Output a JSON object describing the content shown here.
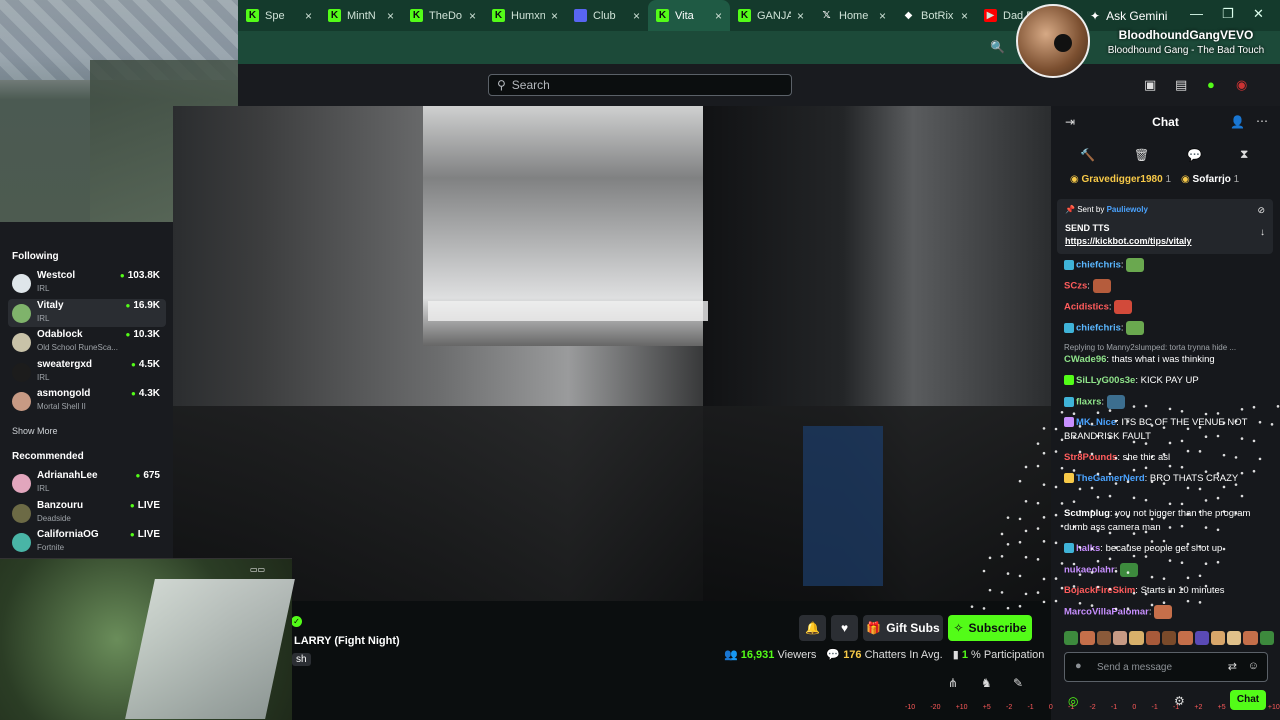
{
  "browser": {
    "tabs": [
      {
        "label": "Spe",
        "fav": "kick",
        "active": false
      },
      {
        "label": "MintN",
        "fav": "kick",
        "active": false
      },
      {
        "label": "TheDo",
        "fav": "kick",
        "active": false
      },
      {
        "label": "Humxn",
        "fav": "kick",
        "active": false
      },
      {
        "label": "Club",
        "fav": "discord",
        "active": false
      },
      {
        "label": "Vita",
        "fav": "kick",
        "active": true
      },
      {
        "label": "GANJA",
        "fav": "kick",
        "active": false
      },
      {
        "label": "Home",
        "fav": "x",
        "active": false
      },
      {
        "label": "BotRix",
        "fav": "botrix",
        "active": false
      },
      {
        "label": "Dad D",
        "fav": "yt",
        "active": false
      }
    ],
    "ask_gemini": "Ask Gemini",
    "zoom_icon": "search-icon"
  },
  "header": {
    "search_placeholder": "Search"
  },
  "now_playing": {
    "artist": "BloodhoundGangVEVO",
    "track": "Bloodhound Gang - The Bad Touch"
  },
  "sidebar": {
    "following_heading": "Following",
    "following": [
      {
        "name": "Westcol",
        "category": "IRL",
        "viewers": "103.8K",
        "color": "#dfe6ea",
        "selected": false
      },
      {
        "name": "Vitaly",
        "category": "IRL",
        "viewers": "16.9K",
        "color": "#7fb36b",
        "selected": true
      },
      {
        "name": "Odablock",
        "category": "Old School RuneSca...",
        "viewers": "10.3K",
        "color": "#c8c2a8",
        "selected": false
      },
      {
        "name": "sweatergxd",
        "category": "IRL",
        "viewers": "4.5K",
        "color": "#1c1c1c",
        "selected": false
      },
      {
        "name": "asmongold",
        "category": "Mortal Shell II",
        "viewers": "4.3K",
        "color": "#c79a84",
        "selected": false
      }
    ],
    "show_more": "Show More",
    "recommended_heading": "Recommended",
    "recommended": [
      {
        "name": "AdrianahLee",
        "category": "IRL",
        "viewers": "675",
        "color": "#e2a6bd"
      },
      {
        "name": "Banzouru",
        "category": "Deadside",
        "viewers": "LIVE",
        "color": "#6c6a45"
      },
      {
        "name": "CaliforniaOG",
        "category": "Fortnite",
        "viewers": "LIVE",
        "color": "#49b5a6"
      }
    ]
  },
  "stream": {
    "title": "LARRY (Fight Night)",
    "category": "sh",
    "gift_subs": "Gift Subs",
    "subscribe": "Subscribe",
    "viewers_count": "16,931",
    "viewers_label": "Viewers",
    "chatters_count": "176",
    "chatters_label": "Chatters In Avg.",
    "participation_value": "1",
    "participation_label": "% Participation"
  },
  "chat": {
    "title": "Chat",
    "leaderboard": [
      {
        "name": "Gravedigger1980",
        "count": "1",
        "color": "#f7c948"
      },
      {
        "name": "Sofarrjo",
        "count": "1",
        "color": "#fff"
      }
    ],
    "pinned": {
      "sent_by": "Sent by",
      "user": "Pauliewoly",
      "message": "SEND TTS",
      "link": "https://kickbot.com/tips/vitaly"
    },
    "reply_hint": "Replying to Manny2slumped: torta trynna hide ...",
    "messages": [
      {
        "user": "chiefchris",
        "color": "#5ab7ff",
        "text": "",
        "emote": "#6aa84f",
        "badge": "#3fb3d8"
      },
      {
        "user": "SCzs",
        "color": "#ff5c5c",
        "text": "",
        "emote": "#b55c3c",
        "badge": ""
      },
      {
        "user": "Acidistics",
        "color": "#ff5c5c",
        "text": "",
        "emote": "#d24a3a",
        "badge": ""
      },
      {
        "user": "chiefchris",
        "color": "#5ab7ff",
        "text": "",
        "emote": "#6aa84f",
        "badge": "#3fb3d8"
      },
      {
        "user": "CWade96",
        "color": "#8fe38a",
        "text": "thats what i was thinking",
        "emote": "",
        "badge": ""
      },
      {
        "user": "SiLLyG00s3e",
        "color": "#8fe38a",
        "text": "KICK PAY UP",
        "emote": "",
        "badge": "#53fc18"
      },
      {
        "user": "flaxrs",
        "color": "#8fe38a",
        "text": "",
        "emote": "#3c6e8f",
        "badge": "#3fb3d8"
      },
      {
        "user": "MK_Nice",
        "color": "#4aa3ff",
        "text": "ITS BC OF THE VENUE NOT BRANDRISK FAULT",
        "emote": "",
        "badge": "#c78fff"
      },
      {
        "user": "Str8Pounds",
        "color": "#ff5c5c",
        "text": "she thic asl",
        "emote": "",
        "badge": ""
      },
      {
        "user": "TheGamerNerd",
        "color": "#4aa3ff",
        "text": "BRO THATS CRAZY",
        "emote": "",
        "badge": "#f7c948"
      },
      {
        "user": "Scumplug",
        "color": "#fff",
        "text": "you not bigger than the program dumb ass camera man",
        "emote": "",
        "badge": ""
      },
      {
        "user": "halks",
        "color": "#c78fff",
        "text": "because people get shot up",
        "emote": "",
        "badge": "#3fb3d8"
      },
      {
        "user": "nukaeolahr",
        "color": "#c78fff",
        "text": "",
        "emote": "#3d8a3d",
        "badge": ""
      },
      {
        "user": "BojackFireSkim",
        "color": "#ff5c5c",
        "text": "Starts in 10 minutes",
        "emote": "",
        "badge": ""
      },
      {
        "user": "MarcoVillaPalomar",
        "color": "#c78fff",
        "text": "",
        "emote": "#c56f4a",
        "badge": ""
      }
    ],
    "input_placeholder": "Send a message",
    "send_label": "Chat"
  },
  "overlay": {
    "eq_values": [
      "-10",
      "-20",
      "+10",
      "+5",
      "-2",
      "-1",
      "0",
      "-1",
      "-2",
      "-1",
      "0",
      "-1",
      "-1",
      "+2",
      "+5",
      "+10",
      "+10"
    ]
  },
  "colors": {
    "kick_green": "#53fc18",
    "tab_bar": "#143a2c",
    "panel": "#191b1f"
  }
}
